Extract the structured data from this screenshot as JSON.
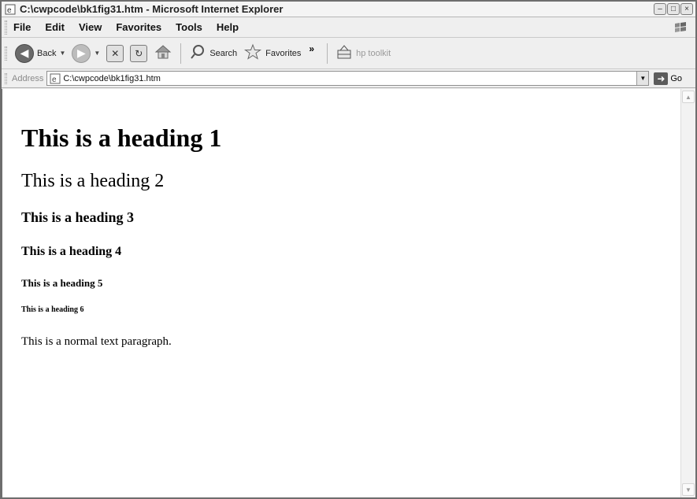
{
  "window": {
    "title": "C:\\cwpcode\\bk1fig31.htm - Microsoft Internet Explorer",
    "controls": {
      "minimize": "–",
      "maximize": "□",
      "close": "×"
    }
  },
  "menu": {
    "items": [
      "File",
      "Edit",
      "View",
      "Favorites",
      "Tools",
      "Help"
    ]
  },
  "toolbar": {
    "back_label": "Back",
    "search_label": "Search",
    "favorites_label": "Favorites",
    "more_label": "»",
    "hp_toolkit_label": "hp toolkit"
  },
  "address": {
    "label": "Address",
    "value": "C:\\cwpcode\\bk1fig31.htm",
    "go_label": "Go"
  },
  "page": {
    "h1": "This is a heading 1",
    "h2": "This is a heading 2",
    "h3": "This is a heading 3",
    "h4": "This is a heading 4",
    "h5": "This is a heading 5",
    "h6": "This is a heading 6",
    "paragraph": "This is a normal text paragraph."
  },
  "icons": {
    "app": "ie-page-icon",
    "windows_flag": "windows-flag-icon",
    "back": "back-arrow-icon",
    "forward": "forward-arrow-icon",
    "stop": "stop-icon",
    "refresh": "refresh-icon",
    "home": "home-icon",
    "search": "search-icon",
    "favorites": "favorites-star-icon",
    "hp_toolkit": "hp-toolkit-icon",
    "go": "go-arrow-icon"
  }
}
